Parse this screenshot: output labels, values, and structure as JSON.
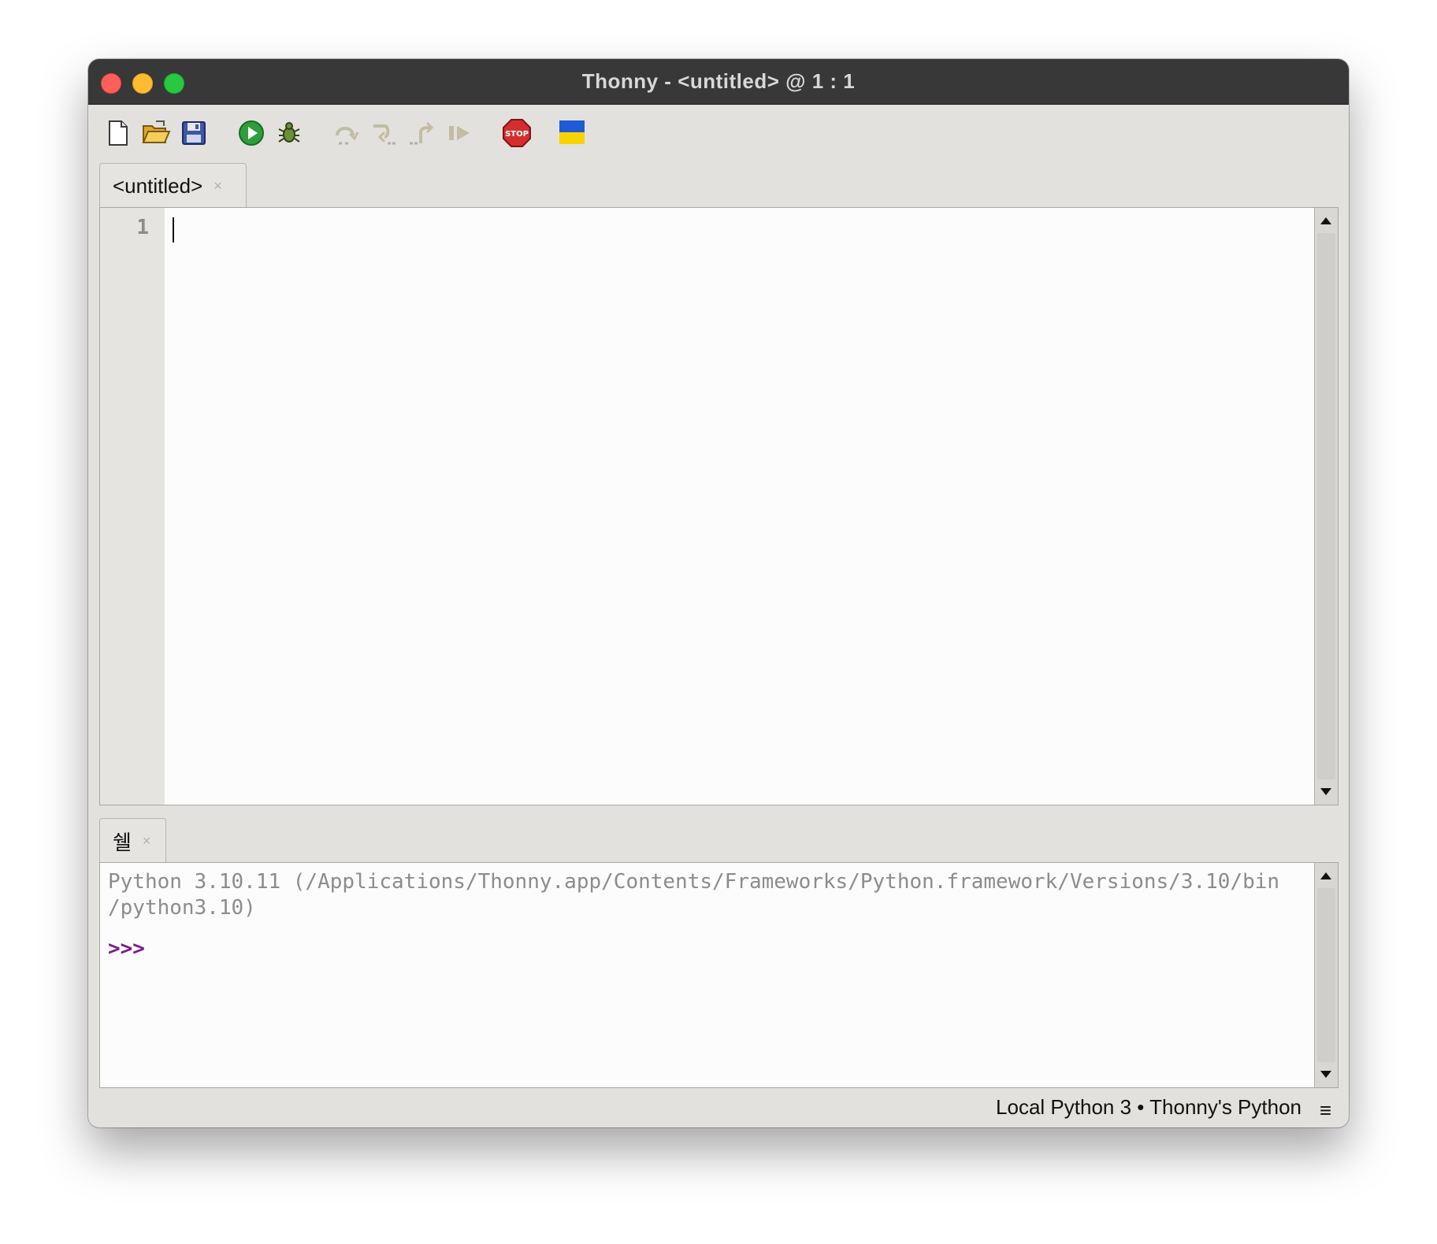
{
  "window": {
    "title": "Thonny  -  <untitled>  @  1 : 1"
  },
  "toolbar": {
    "buttons": [
      {
        "name": "new-file",
        "icon": "new-file-icon",
        "enabled": true
      },
      {
        "name": "open-file",
        "icon": "folder-open-icon",
        "enabled": true
      },
      {
        "name": "save-file",
        "icon": "floppy-disk-icon",
        "enabled": true
      },
      {
        "name": "run",
        "icon": "play-icon",
        "enabled": true
      },
      {
        "name": "debug",
        "icon": "bug-icon",
        "enabled": true
      },
      {
        "name": "step-over",
        "icon": "step-over-icon",
        "enabled": false
      },
      {
        "name": "step-into",
        "icon": "step-into-icon",
        "enabled": false
      },
      {
        "name": "step-out",
        "icon": "step-out-icon",
        "enabled": false
      },
      {
        "name": "resume",
        "icon": "resume-icon",
        "enabled": false
      },
      {
        "name": "stop",
        "icon": "stop-sign-icon",
        "label": "STOP",
        "enabled": true
      },
      {
        "name": "ukraine",
        "icon": "ukraine-flag-icon",
        "enabled": true
      }
    ]
  },
  "editor": {
    "tab_label": "<untitled>",
    "tab_close": "×",
    "line_numbers": [
      "1"
    ]
  },
  "shell": {
    "tab_label": "쉘",
    "tab_close": "×",
    "banner": "Python 3.10.11 (/Applications/Thonny.app/Contents/Frameworks/Python.framework/Versions/3.10/bin\n/python3.10)",
    "prompt": ">>>"
  },
  "statusbar": {
    "interpreter": "Local Python 3  •  Thonny's Python",
    "menu_icon": "≡"
  },
  "colors": {
    "titlebar": "#383838",
    "prompt": "#7a1a8a",
    "stop": "#d32f2f",
    "flag_blue": "#1f5bd6",
    "flag_yellow": "#f7d400"
  }
}
